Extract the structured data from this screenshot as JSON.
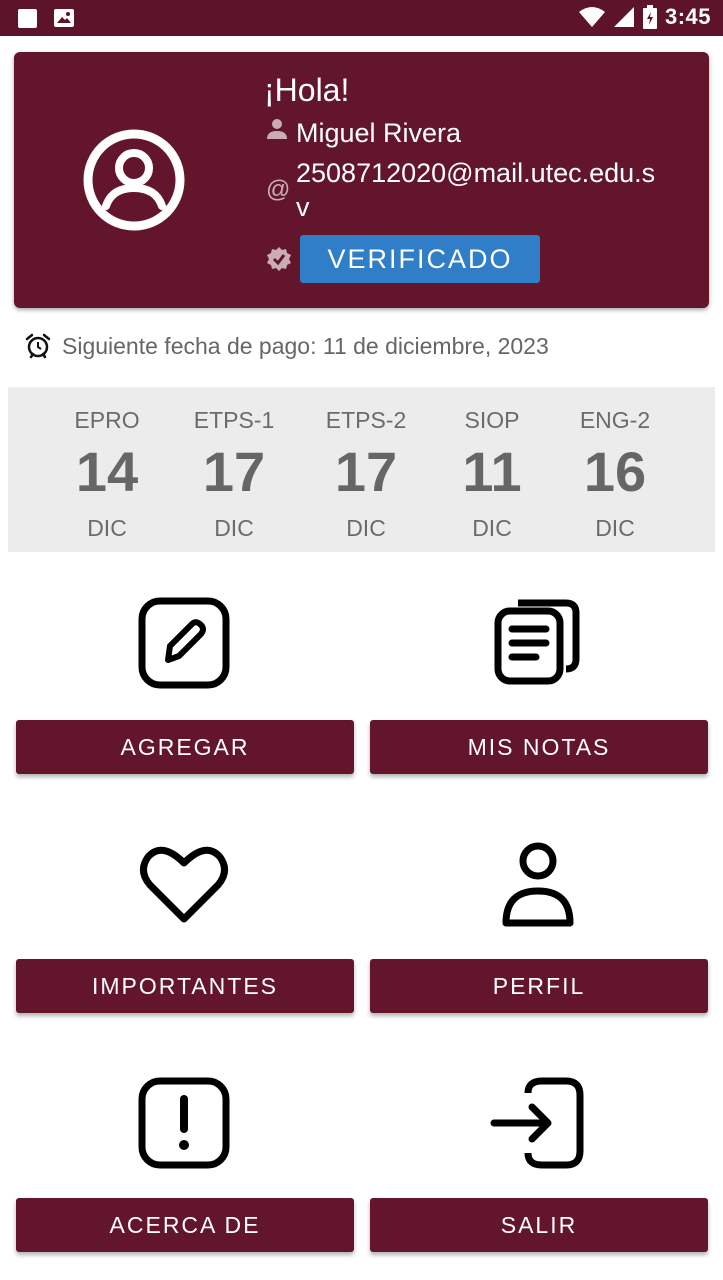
{
  "status_bar": {
    "time": "3:45"
  },
  "profile": {
    "greeting": "¡Hola!",
    "name": "Miguel Rivera",
    "email": "2508712020@mail.utec.edu.sv",
    "verified_label": "VERIFICADO"
  },
  "payment": {
    "text": "Siguiente fecha de pago: 11 de diciembre, 2023"
  },
  "dates": [
    {
      "code": "EPRO",
      "day": "14",
      "month": "DIC"
    },
    {
      "code": "ETPS-1",
      "day": "17",
      "month": "DIC"
    },
    {
      "code": "ETPS-2",
      "day": "17",
      "month": "DIC"
    },
    {
      "code": "SIOP",
      "day": "11",
      "month": "DIC"
    },
    {
      "code": "ENG-2",
      "day": "16",
      "month": "DIC"
    }
  ],
  "actions": {
    "add": {
      "label": "AGREGAR",
      "icon": "edit-icon"
    },
    "notes": {
      "label": "MIS NOTAS",
      "icon": "notes-icon"
    },
    "important": {
      "label": "IMPORTANTES",
      "icon": "heart-icon"
    },
    "profile": {
      "label": "PERFIL",
      "icon": "person-icon"
    },
    "about": {
      "label": "ACERCA DE",
      "icon": "alert-icon"
    },
    "exit": {
      "label": "SALIR",
      "icon": "login-icon"
    }
  },
  "colors": {
    "brand": "#63152b",
    "verified": "#2f7ec7",
    "status_bar": "#5e1428"
  }
}
